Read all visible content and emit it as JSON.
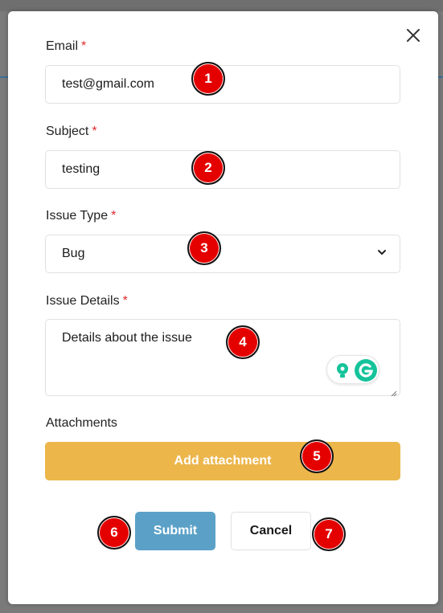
{
  "form": {
    "email": {
      "label": "Email",
      "required_mark": "*",
      "value": "test@gmail.com"
    },
    "subject": {
      "label": "Subject",
      "required_mark": "*",
      "value": "testing"
    },
    "issue_type": {
      "label": "Issue Type",
      "required_mark": "*",
      "selected": "Bug"
    },
    "issue_details": {
      "label": "Issue Details",
      "required_mark": "*",
      "value": "Details about the issue"
    },
    "attachments": {
      "label": "Attachments",
      "button_label": "Add attachment"
    },
    "submit_label": "Submit",
    "cancel_label": "Cancel"
  },
  "markers": [
    "1",
    "2",
    "3",
    "4",
    "5",
    "6",
    "7"
  ],
  "icons": {
    "close": "close-icon",
    "dropdown": "chevron-down-icon",
    "grammarly_bulb": "lightbulb-icon",
    "grammarly_logo": "grammarly-icon"
  },
  "colors": {
    "accent_attach": "#ecb64b",
    "submit": "#5ba1c7",
    "required": "#e0282e",
    "marker": "#e50000",
    "grammarly": "#15c39a"
  }
}
